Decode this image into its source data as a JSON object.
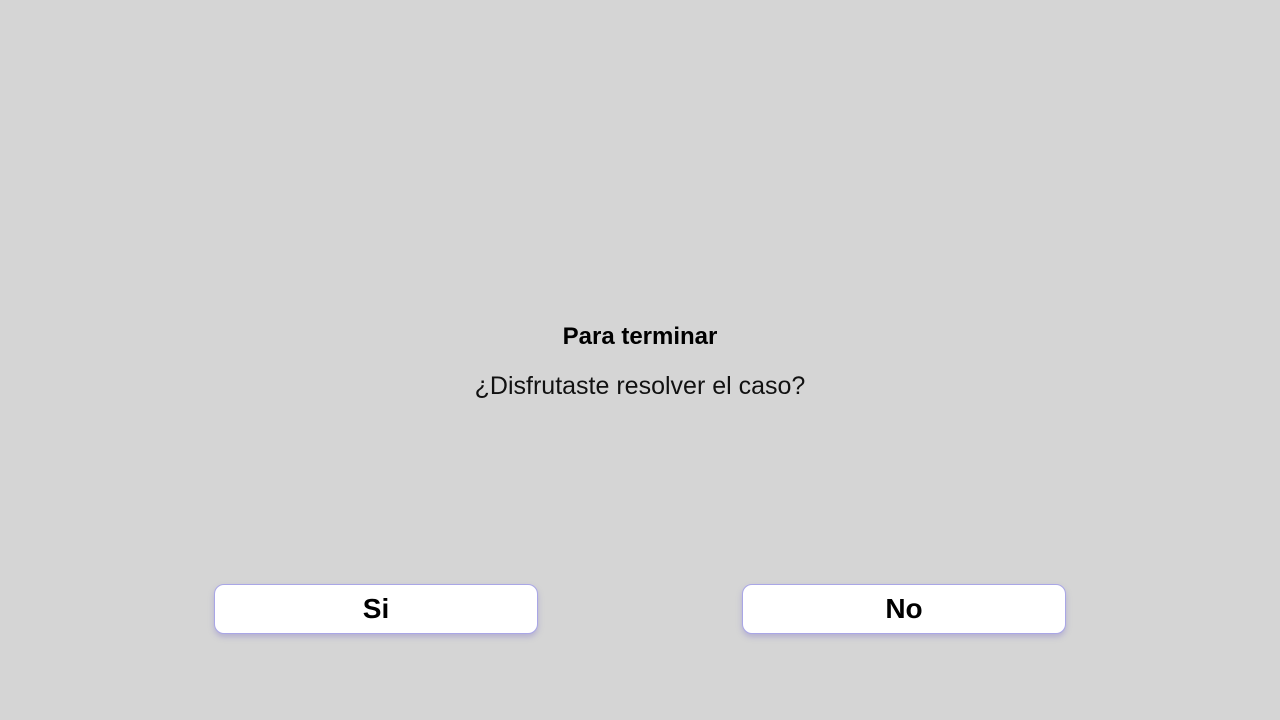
{
  "screen": {
    "heading": "Para terminar",
    "question": "¿Disfrutaste resolver el caso?"
  },
  "answers": {
    "yes_label": "Si",
    "no_label": "No"
  },
  "colors": {
    "background": "#d5d5d5",
    "button_background": "#ffffff",
    "button_border": "#a9a6e6",
    "text": "#000000"
  }
}
